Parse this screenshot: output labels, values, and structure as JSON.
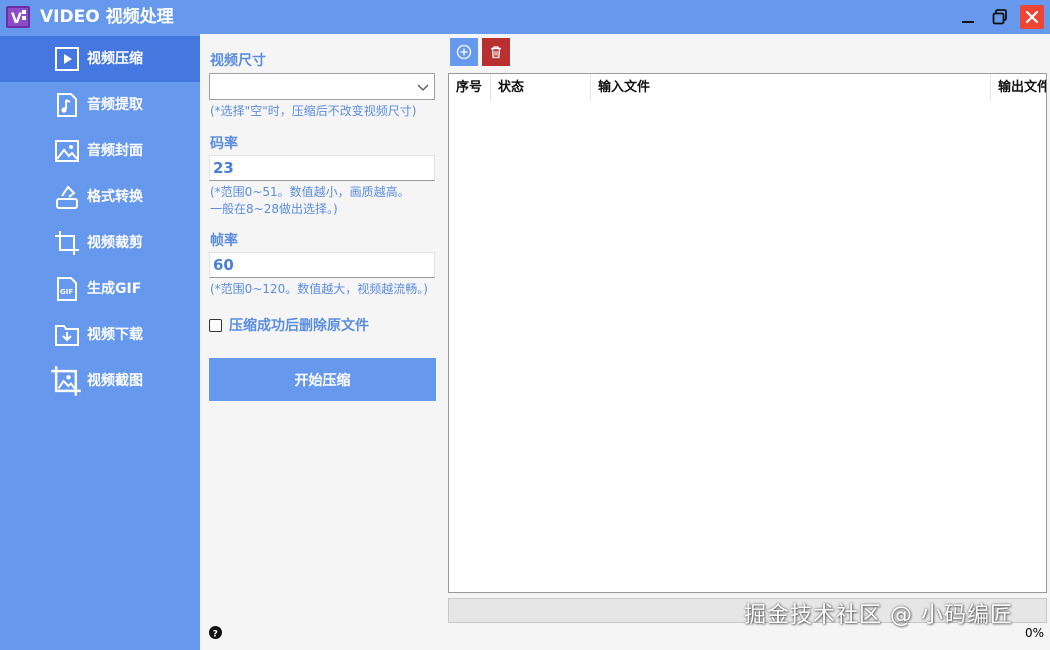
{
  "window": {
    "logo_text": "V",
    "title": "VIDEO 视频处理"
  },
  "sidebar": {
    "items": [
      {
        "label": "视频压缩",
        "icon": "play-icon",
        "active": true
      },
      {
        "label": "音频提取",
        "icon": "music-file-icon",
        "active": false
      },
      {
        "label": "音频封面",
        "icon": "image-icon",
        "active": false
      },
      {
        "label": "格式转换",
        "icon": "convert-icon",
        "active": false
      },
      {
        "label": "视频裁剪",
        "icon": "crop-icon",
        "active": false
      },
      {
        "label": "生成GIF",
        "icon": "gif-file-icon",
        "active": false
      },
      {
        "label": "视频下载",
        "icon": "download-folder-icon",
        "active": false
      },
      {
        "label": "视频截图",
        "icon": "screenshot-icon",
        "active": false
      }
    ]
  },
  "form": {
    "size_label": "视频尺寸",
    "size_value": "",
    "size_hint": "(*选择\"空\"时，压缩后不改变视频尺寸)",
    "bitrate_label": "码率",
    "bitrate_value": "23",
    "bitrate_hint_1": "(*范围0~51。数值越小，画质越高。",
    "bitrate_hint_2": "一般在8~28做出选择。)",
    "framerate_label": "帧率",
    "framerate_value": "60",
    "framerate_hint": "(*范围0~120。数值越大，视频越流畅。)",
    "delete_original_label": "压缩成功后删除原文件",
    "delete_original_checked": false,
    "start_button": "开始压缩",
    "help_icon": "question-icon"
  },
  "toolbar": {
    "add_icon": "plus-circle-icon",
    "delete_icon": "trash-icon"
  },
  "table": {
    "columns": [
      "序号",
      "状态",
      "输入文件",
      "输出文件"
    ],
    "rows": []
  },
  "progress": {
    "value": 0,
    "text": "0%"
  },
  "watermark": "掘金技术社区 @ 小码编匠",
  "colors": {
    "accent": "#6699ee",
    "accent_active": "#4477e0",
    "label_text": "#5b8de0",
    "close_button": "#ee4433",
    "delete_button": "#b83030"
  }
}
